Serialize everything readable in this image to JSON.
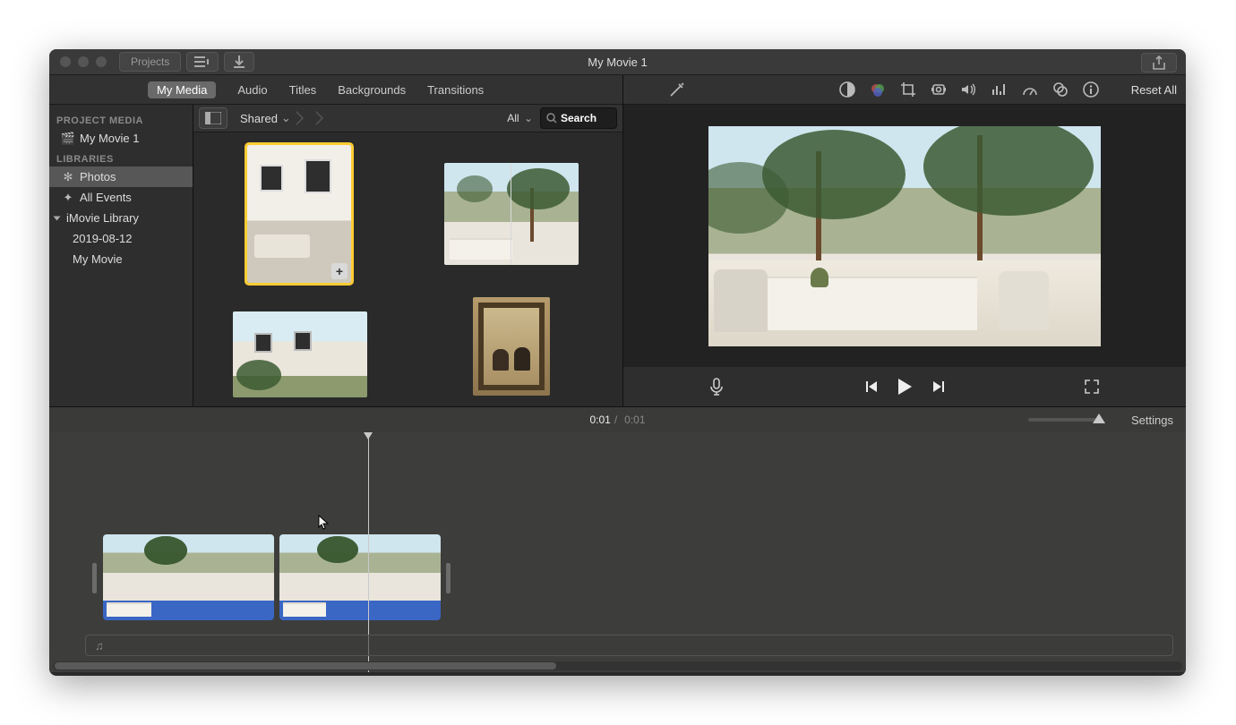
{
  "titlebar": {
    "projects_label": "Projects",
    "window_title": "My Movie 1"
  },
  "tabs": {
    "my_media": "My Media",
    "audio": "Audio",
    "titles": "Titles",
    "backgrounds": "Backgrounds",
    "transitions": "Transitions"
  },
  "sidebar": {
    "project_media_header": "PROJECT MEDIA",
    "project_name": "My Movie 1",
    "libraries_header": "LIBRARIES",
    "items": [
      {
        "label": "Photos"
      },
      {
        "label": "All Events"
      },
      {
        "label": "iMovie Library"
      },
      {
        "label": "2019-08-12"
      },
      {
        "label": "My Movie"
      }
    ]
  },
  "browser": {
    "crumb": "Shared",
    "filter": "All",
    "search_placeholder": "Search"
  },
  "adjust": {
    "reset_label": "Reset All"
  },
  "timeline": {
    "current": "0:01",
    "total": "0:01",
    "settings_label": "Settings",
    "audio_note": "♫"
  }
}
